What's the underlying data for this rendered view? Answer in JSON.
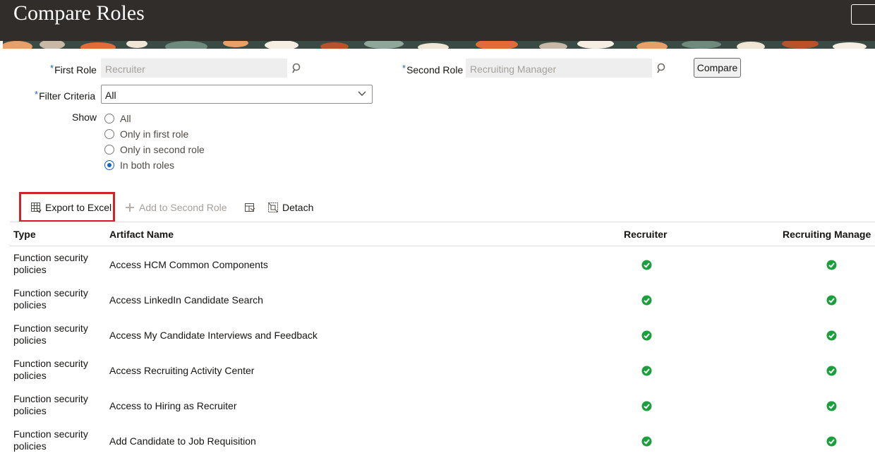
{
  "header": {
    "title": "Compare Roles"
  },
  "form": {
    "first_role": {
      "label": "First Role",
      "value": "Recruiter"
    },
    "second_role": {
      "label": "Second Role",
      "value": "Recruiting Manager"
    },
    "compare_label": "Compare",
    "filter": {
      "label": "Filter Criteria",
      "value": "All"
    },
    "show": {
      "label": "Show",
      "options": [
        "All",
        "Only in first role",
        "Only in second role",
        "In both roles"
      ],
      "selected": "In both roles"
    }
  },
  "toolbar": {
    "export_label": "Export to Excel",
    "add_label": "Add to Second Role",
    "detach_label": "Detach"
  },
  "table": {
    "columns": [
      "Type",
      "Artifact Name",
      "Recruiter",
      "Recruiting Manage"
    ],
    "rows": [
      {
        "type": "Function security policies",
        "name": "Access HCM Common Components",
        "first": true,
        "second": true
      },
      {
        "type": "Function security policies",
        "name": "Access LinkedIn Candidate Search",
        "first": true,
        "second": true
      },
      {
        "type": "Function security policies",
        "name": "Access My Candidate Interviews and Feedback",
        "first": true,
        "second": true
      },
      {
        "type": "Function security policies",
        "name": "Access Recruiting Activity Center",
        "first": true,
        "second": true
      },
      {
        "type": "Function security policies",
        "name": "Access to Hiring as Recruiter",
        "first": true,
        "second": true
      },
      {
        "type": "Function security policies",
        "name": "Add Candidate to Job Requisition",
        "first": true,
        "second": true
      }
    ]
  },
  "colors": {
    "header_bg": "#312d2a",
    "accent": "#1864c1",
    "highlight": "#d3222a",
    "check": "#1a9f3c"
  },
  "icons": [
    "search-icon",
    "chevron-down-icon",
    "export-excel-icon",
    "add-icon",
    "freeze-column-icon",
    "detach-icon",
    "check-circle-icon"
  ]
}
